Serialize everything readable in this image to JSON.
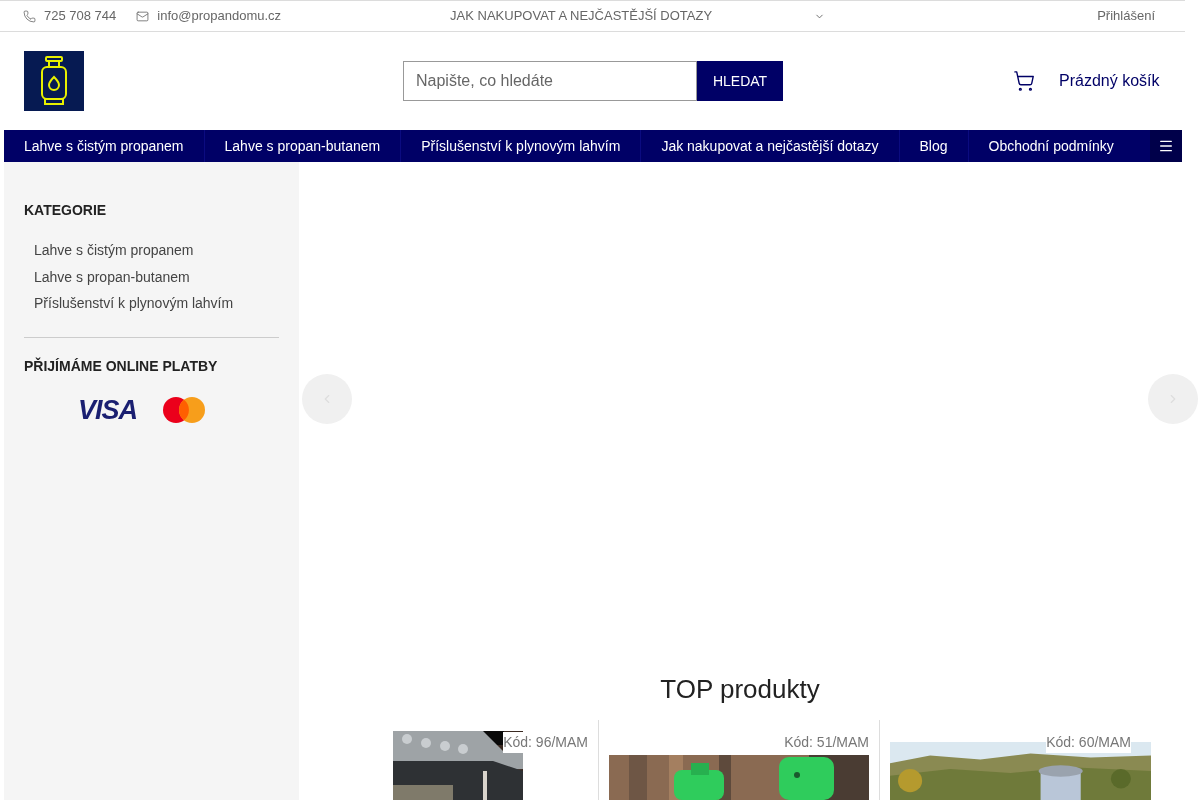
{
  "top_bar": {
    "phone": "725 708 744",
    "email": "info@propandomu.cz",
    "link": "JAK NAKUPOVAT A NEJČASTĚJŠÍ DOTAZY",
    "login": "Přihlášení"
  },
  "header": {
    "search": {
      "placeholder": "Napište, co hledáte",
      "button": "HLEDAT"
    },
    "cart": "Prázdný košík"
  },
  "nav": [
    "Lahve s čistým propanem",
    "Lahve s propan-butanem",
    "Příslušenství k plynovým lahvím",
    "Jak nakupovat a nejčastější dotazy",
    "Blog",
    "Obchodní podmínky"
  ],
  "sidebar": {
    "title": "KATEGORIE",
    "categories": [
      "Lahve s čistým propanem",
      "Lahve s propan-butanem",
      "Příslušenství k plynovým lahvím"
    ],
    "payments_title": "PŘIJÍMÁME ONLINE PLATBY",
    "visa": "VISA"
  },
  "top_products": {
    "title": "TOP produkty",
    "products": [
      {
        "code": "Kód: 96/MAM",
        "kind": "grill"
      },
      {
        "code": "Kód: 51/MAM",
        "kind": "bottles"
      },
      {
        "code": "Kód: 60/MAM",
        "kind": "landscape"
      }
    ]
  }
}
